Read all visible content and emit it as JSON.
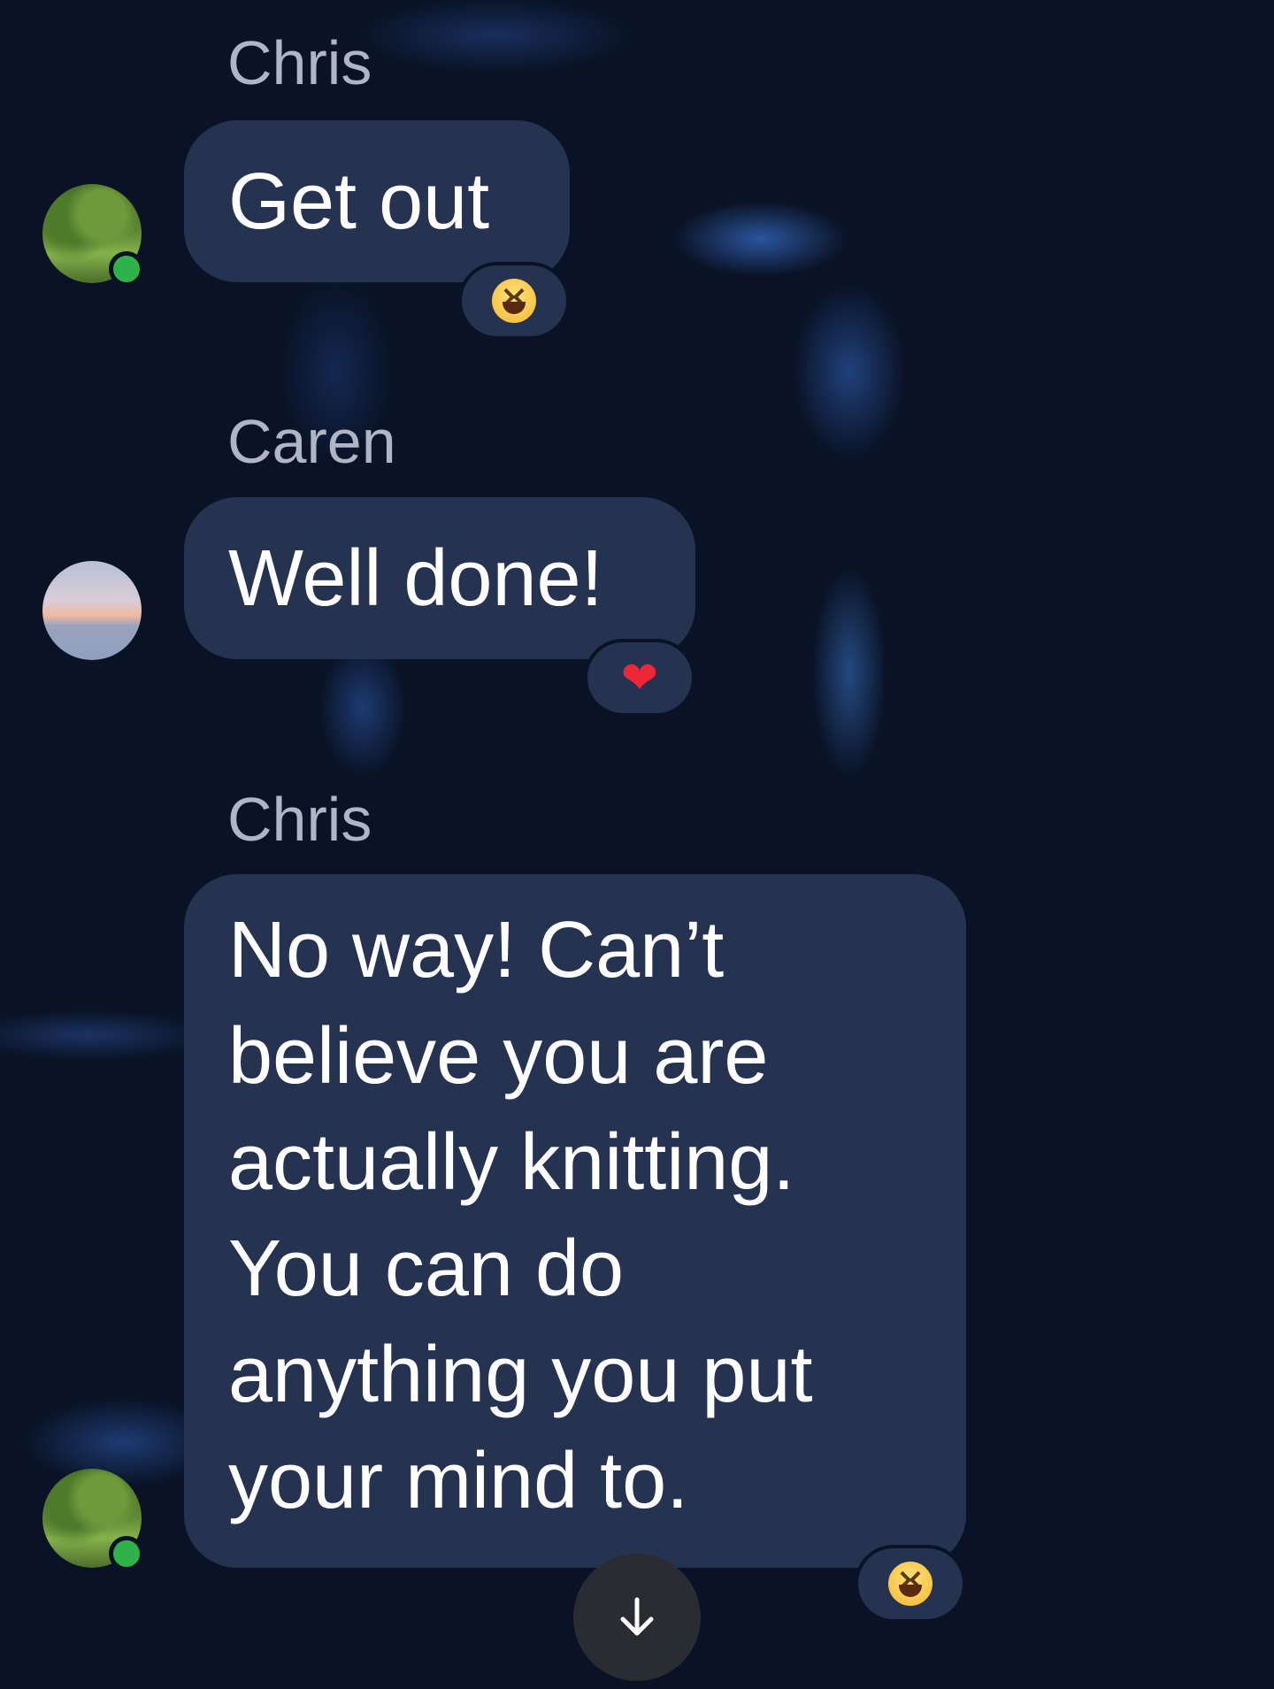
{
  "messages": [
    {
      "sender": "Chris",
      "text": "Get out",
      "avatar": "garden-avatar",
      "online": true,
      "reaction": "laughing-emoji"
    },
    {
      "sender": "Caren",
      "text": "Well done!",
      "avatar": "sunset-avatar",
      "online": false,
      "reaction": "heart-emoji"
    },
    {
      "sender": "Chris",
      "text_lines": [
        "No way! Can’t",
        "believe you are",
        "actually knitting.",
        "You can do",
        "anything you put",
        "your mind to."
      ],
      "avatar": "garden-avatar",
      "online": true,
      "reaction": "laughing-emoji"
    }
  ],
  "reactions": {
    "laugh": "😆",
    "heart": "❤"
  },
  "scroll_down_icon": "arrow-down-icon",
  "colors": {
    "background": "#0a1326",
    "bubble": "#253250",
    "online": "#2fb24a",
    "sender_name": "#aeb5c4",
    "heart": "#ee2737"
  }
}
